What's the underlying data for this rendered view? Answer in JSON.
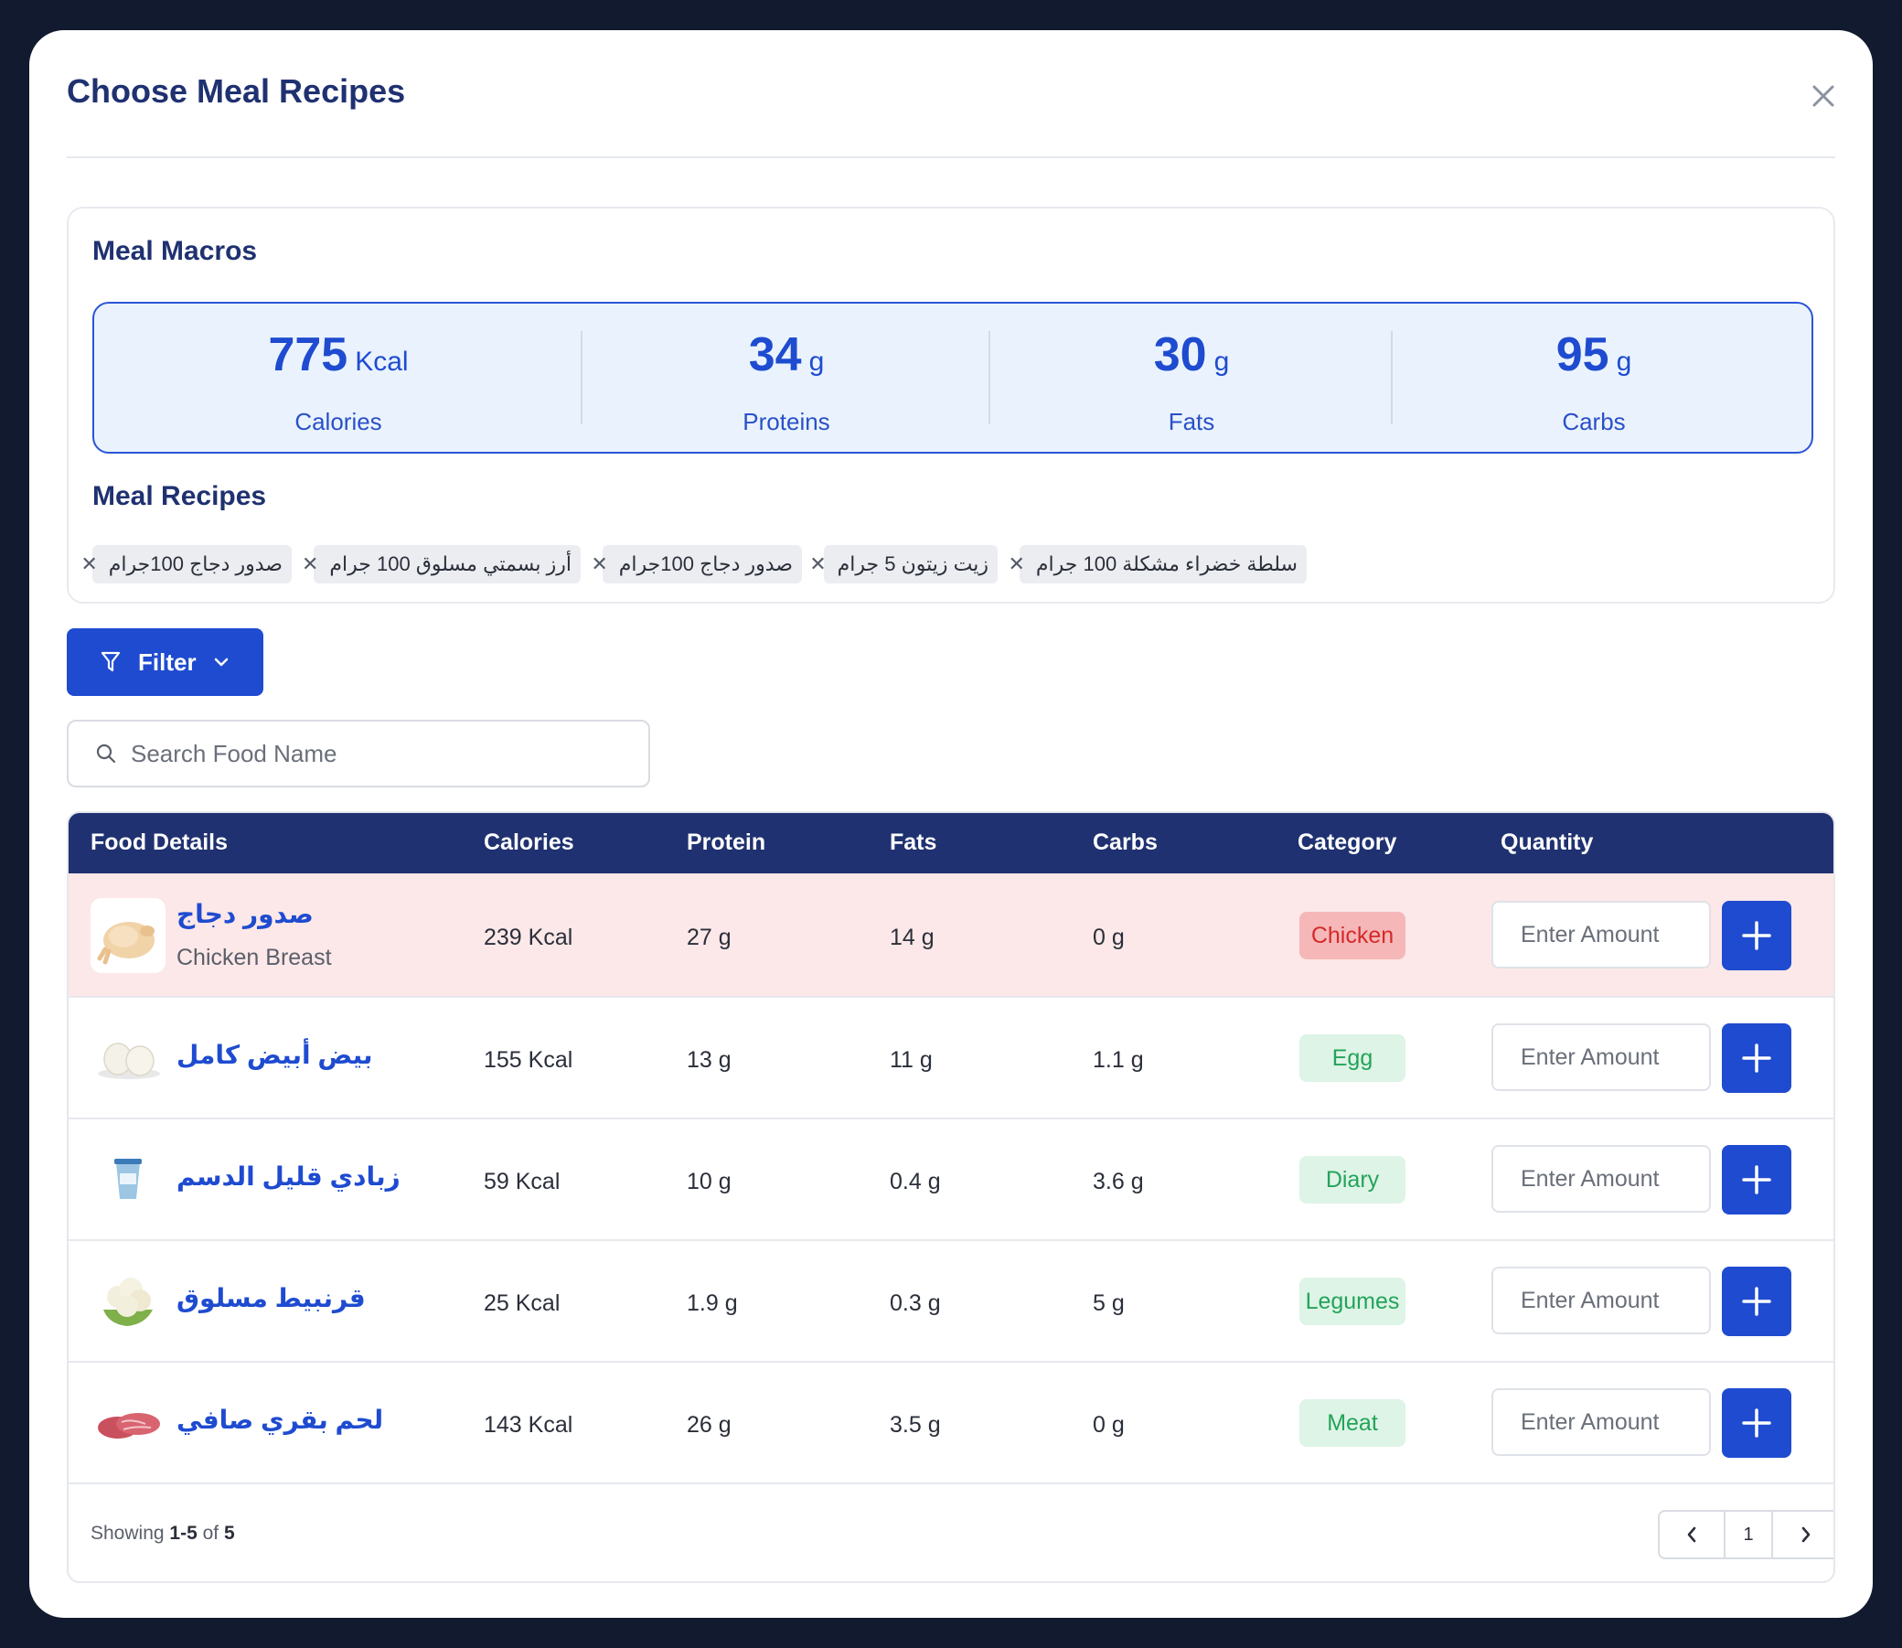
{
  "modal": {
    "title": "Choose Meal Recipes",
    "close_icon": "close-icon"
  },
  "macros": {
    "title": "Meal Macros",
    "items": [
      {
        "value": "775",
        "unit": "Kcal",
        "label": "Calories"
      },
      {
        "value": "34",
        "unit": "g",
        "label": "Proteins"
      },
      {
        "value": "30",
        "unit": "g",
        "label": "Fats"
      },
      {
        "value": "95",
        "unit": "g",
        "label": "Carbs"
      }
    ]
  },
  "recipes": {
    "title": "Meal Recipes",
    "chips": [
      {
        "label": "صدور دجاج 100جرام"
      },
      {
        "label": "أرز بسمتي مسلوق 100 جرام"
      },
      {
        "label": "صدور دجاج 100جرام"
      },
      {
        "label": "زيت زيتون 5 جرام"
      },
      {
        "label": "سلطة خضراء مشكلة 100 جرام"
      }
    ]
  },
  "filter": {
    "label": "Filter"
  },
  "search": {
    "placeholder": "Search Food Name"
  },
  "table": {
    "headers": [
      "Food Details",
      "Calories",
      "Protein",
      "Fats",
      "Carbs",
      "Category",
      "Quantity"
    ],
    "rows": [
      {
        "name": "صدور دجاج",
        "subtitle": "Chicken Breast",
        "calories": "239 Kcal",
        "protein": "27 g",
        "fats": "14 g",
        "carbs": "0 g",
        "category": "Chicken",
        "placeholder": "Enter Amount",
        "image": "chicken-image"
      },
      {
        "name": "بيض أبيض كامل",
        "calories": "155 Kcal",
        "protein": "13 g",
        "fats": "11 g",
        "carbs": "1.1 g",
        "category": "Egg",
        "placeholder": "Enter Amount",
        "image": "egg-image"
      },
      {
        "name": "زبادي قليل الدسم",
        "calories": "59 Kcal",
        "protein": "10 g",
        "fats": "0.4 g",
        "carbs": "3.6 g",
        "category": "Diary",
        "placeholder": "Enter Amount",
        "image": "yogurt-image"
      },
      {
        "name": "قرنبيط مسلوق",
        "calories": "25 Kcal",
        "protein": "1.9 g",
        "fats": "0.3 g",
        "carbs": "5 g",
        "category": "Legumes",
        "placeholder": "Enter Amount",
        "image": "cauliflower-image"
      },
      {
        "name": "لحم بقري صافي",
        "calories": "143 Kcal",
        "protein": "26 g",
        "fats": "3.5 g",
        "carbs": "0 g",
        "category": "Meat",
        "placeholder": "Enter Amount",
        "image": "beef-image"
      }
    ]
  },
  "footer": {
    "showing_prefix": "Showing",
    "range": "1-5",
    "of": "of",
    "total": "5"
  },
  "pagination": {
    "current": "1"
  },
  "colors": {
    "primary": "#1e4bd0",
    "navy": "#1f3170",
    "highlight_row": "#fce8e8",
    "red_badge": "#f6b7b8",
    "green_badge": "#ddf4e6"
  }
}
